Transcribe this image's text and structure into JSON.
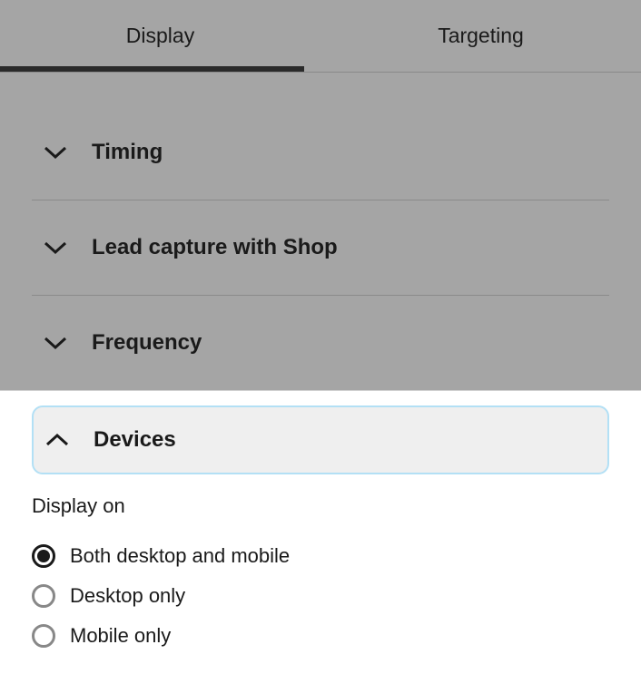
{
  "tabs": {
    "display": "Display",
    "targeting": "Targeting",
    "active": "display"
  },
  "accordion": {
    "timing": "Timing",
    "lead_capture": "Lead capture with Shop",
    "frequency": "Frequency",
    "devices": "Devices"
  },
  "devices_section": {
    "label": "Display on",
    "options": [
      "Both desktop and mobile",
      "Desktop only",
      "Mobile only"
    ],
    "selected": 0
  }
}
